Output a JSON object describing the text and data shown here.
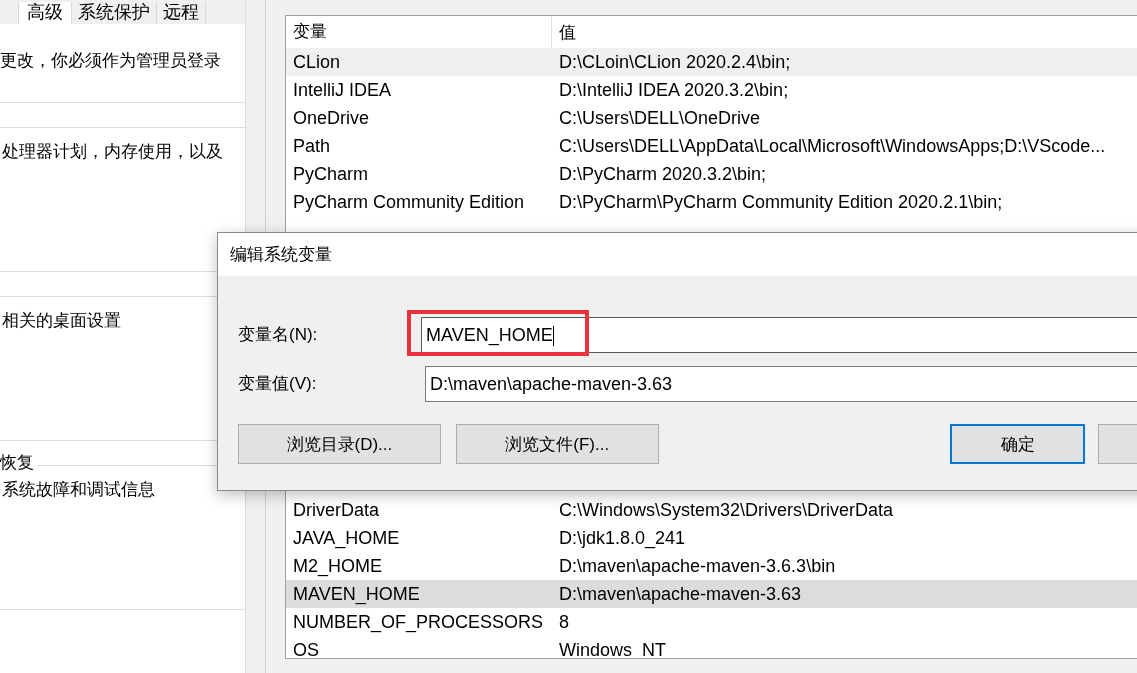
{
  "left_panel": {
    "tabs": [
      {
        "label": "高级",
        "selected": true
      },
      {
        "label": "系统保护",
        "selected": false
      },
      {
        "label": "远程",
        "selected": false
      }
    ],
    "admin_note": "更改，你必须作为管理员登录",
    "sections": [
      {
        "text": "处理器计划，内存使用，以及"
      },
      {
        "text": "相关的桌面设置"
      },
      {
        "title": "恢复",
        "text": "系统故障和调试信息"
      }
    ]
  },
  "variables_table": {
    "columns": [
      "变量",
      "值"
    ],
    "rows_top": [
      {
        "name": "CLion",
        "value": "D:\\CLoin\\CLion 2020.2.4\\bin;",
        "selected": false,
        "hover": true
      },
      {
        "name": "IntelliJ IDEA",
        "value": "D:\\IntelliJ IDEA 2020.3.2\\bin;",
        "selected": false,
        "hover": false
      },
      {
        "name": "OneDrive",
        "value": "C:\\Users\\DELL\\OneDrive",
        "selected": false,
        "hover": false
      },
      {
        "name": "Path",
        "value": "C:\\Users\\DELL\\AppData\\Local\\Microsoft\\WindowsApps;D:\\VScode...",
        "selected": false,
        "hover": false
      },
      {
        "name": "PyCharm",
        "value": "D:\\PyCharm 2020.3.2\\bin;",
        "selected": false,
        "hover": false
      },
      {
        "name": "PyCharm Community Edition",
        "value": "D:\\PyCharm\\PyCharm Community Edition 2020.2.1\\bin;",
        "selected": false,
        "hover": false
      }
    ],
    "rows_bottom": [
      {
        "name": "DriverData",
        "value": "C:\\Windows\\System32\\Drivers\\DriverData",
        "selected": false,
        "hover": false
      },
      {
        "name": "JAVA_HOME",
        "value": "D:\\jdk1.8.0_241",
        "selected": false,
        "hover": false
      },
      {
        "name": "M2_HOME",
        "value": "D:\\maven\\apache-maven-3.6.3\\bin",
        "selected": false,
        "hover": false
      },
      {
        "name": "MAVEN_HOME",
        "value": "D:\\maven\\apache-maven-3.63",
        "selected": true,
        "hover": false
      },
      {
        "name": "NUMBER_OF_PROCESSORS",
        "value": "8",
        "selected": false,
        "hover": false
      },
      {
        "name": "OS",
        "value": "Windows_NT",
        "selected": false,
        "hover": false
      }
    ]
  },
  "dialog": {
    "title": "编辑系统变量",
    "fields": [
      {
        "label": "变量名(N):",
        "value": "MAVEN_HOME",
        "highlighted": true
      },
      {
        "label": "变量值(V):",
        "value": "D:\\maven\\apache-maven-3.63",
        "highlighted": false
      }
    ],
    "buttons": [
      {
        "label": "浏览目录(D)...",
        "kind": "normal"
      },
      {
        "label": "浏览文件(F)...",
        "kind": "normal"
      },
      {
        "label": "确定",
        "kind": "default"
      },
      {
        "kind": "cut"
      }
    ]
  }
}
